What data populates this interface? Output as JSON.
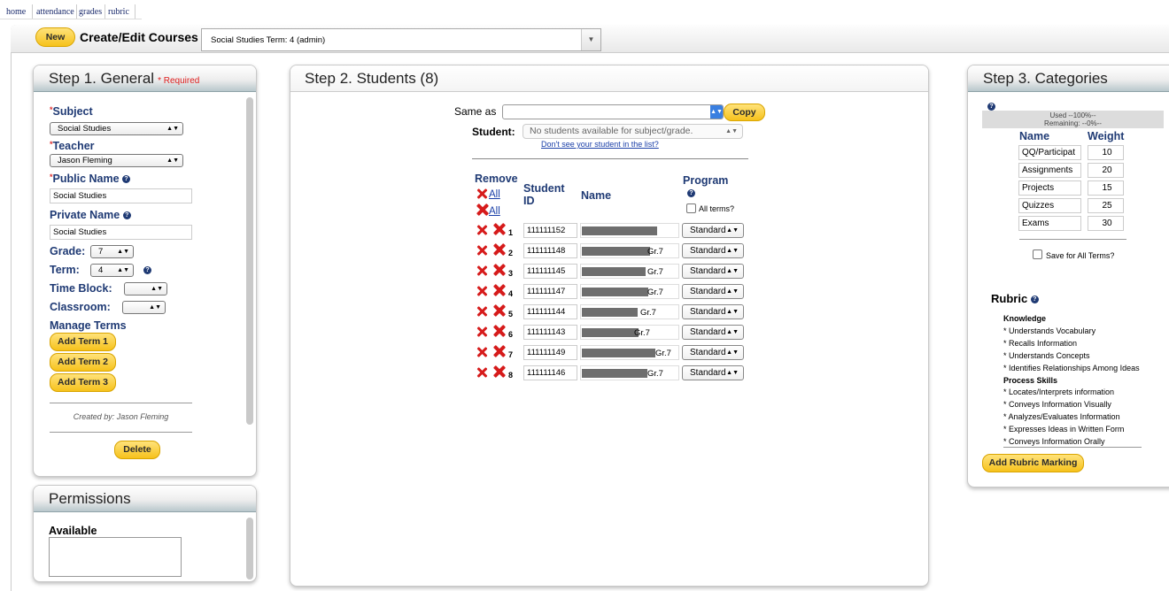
{
  "nav": {
    "home": "home",
    "attendance": "attendance",
    "grades": "grades",
    "rubric": "rubric"
  },
  "header": {
    "new_label": "New",
    "title": "Create/Edit Courses",
    "course_value": "Social Studies Term: 4 (admin)"
  },
  "step1": {
    "title": "Step 1. General",
    "required": "* Required",
    "subject_label": "Subject",
    "subject_value": "Social Studies",
    "teacher_label": "Teacher",
    "teacher_value": "Jason Fleming",
    "public_name_label": "Public Name",
    "public_name_value": "Social Studies",
    "private_name_label": "Private Name",
    "private_name_value": "Social Studies",
    "grade_label": "Grade:",
    "grade_value": "7",
    "term_label": "Term:",
    "term_value": "4",
    "time_block_label": "Time Block:",
    "classroom_label": "Classroom:",
    "manage_terms_label": "Manage Terms",
    "add_terms": [
      "Add Term 1",
      "Add Term 2",
      "Add Term 3"
    ],
    "created_by": "Created by: Jason Fleming",
    "delete_label": "Delete"
  },
  "permissions": {
    "title": "Permissions",
    "available_label": "Available"
  },
  "step2": {
    "title": "Step 2. Students (8)",
    "same_as_label": "Same as",
    "copy_label": "Copy",
    "student_label": "Student:",
    "student_placeholder": "No students available for subject/grade.",
    "missing_link": "Don't see your student in the list?",
    "remove_header": "Remove",
    "all1": "All",
    "all2": "All",
    "id_header1": "Student",
    "id_header2": "ID",
    "name_header": "Name",
    "program_header": "Program",
    "all_terms_label": "All terms?",
    "rows": [
      {
        "n": "1",
        "id": "111111152",
        "grade": "",
        "program": "Standard"
      },
      {
        "n": "2",
        "id": "111111148",
        "grade": "Gr.7",
        "program": "Standard"
      },
      {
        "n": "3",
        "id": "111111145",
        "grade": "Gr.7",
        "program": "Standard"
      },
      {
        "n": "4",
        "id": "111111147",
        "grade": "Gr.7",
        "program": "Standard"
      },
      {
        "n": "5",
        "id": "111111144",
        "grade": "Gr.7",
        "program": "Standard"
      },
      {
        "n": "6",
        "id": "111111143",
        "grade": "Gr.7",
        "program": "Standard"
      },
      {
        "n": "7",
        "id": "111111149",
        "grade": "Gr.7",
        "program": "Standard"
      },
      {
        "n": "8",
        "id": "111111146",
        "grade": "Gr.7",
        "program": "Standard"
      }
    ]
  },
  "step3": {
    "title": "Step 3. Categories",
    "used": "Used --100%--",
    "remaining": "Remaining: --0%--",
    "name_header": "Name",
    "weight_header": "Weight",
    "categories": [
      {
        "name": "QQ/Participat",
        "weight": "10"
      },
      {
        "name": "Assignments",
        "weight": "20"
      },
      {
        "name": "Projects",
        "weight": "15"
      },
      {
        "name": "Quizzes",
        "weight": "25"
      },
      {
        "name": "Exams",
        "weight": "30"
      }
    ],
    "save_all_label": "Save for All Terms?",
    "rubric_title": "Rubric",
    "rubric_lines": [
      {
        "text": "Knowledge",
        "heading": true
      },
      {
        "text": "* Understands Vocabulary",
        "heading": false
      },
      {
        "text": "* Recalls Information",
        "heading": false
      },
      {
        "text": "* Understands Concepts",
        "heading": false
      },
      {
        "text": "* Identifies Relationships Among Ideas",
        "heading": false
      },
      {
        "text": "Process Skills",
        "heading": true
      },
      {
        "text": "* Locates/Interprets information",
        "heading": false
      },
      {
        "text": "* Conveys Information Visually",
        "heading": false
      },
      {
        "text": "* Analyzes/Evaluates Information",
        "heading": false
      },
      {
        "text": "* Expresses Ideas in Written Form",
        "heading": false
      },
      {
        "text": "* Conveys Information Orally",
        "heading": false
      }
    ],
    "add_rubric_label": "Add Rubric Marking"
  }
}
